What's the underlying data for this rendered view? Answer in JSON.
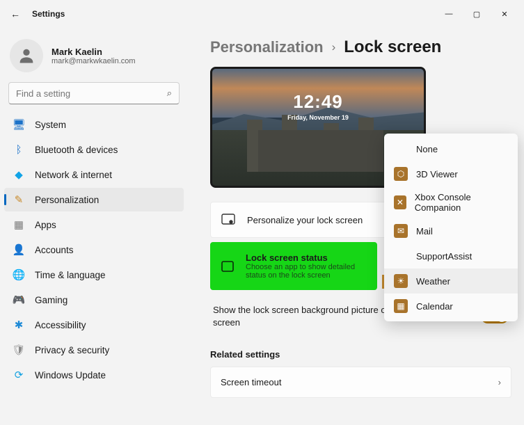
{
  "app": {
    "title": "Settings",
    "back_glyph": "←"
  },
  "window_controls": {
    "min": "—",
    "max": "▢",
    "close": "✕"
  },
  "profile": {
    "name": "Mark Kaelin",
    "email": "mark@markwkaelin.com"
  },
  "search": {
    "placeholder": "Find a setting"
  },
  "sidebar": {
    "items": [
      {
        "label": "System",
        "glyph": "🖥",
        "color": "#1e73c9"
      },
      {
        "label": "Bluetooth & devices",
        "glyph": "ᛒ",
        "color": "#1e73c9"
      },
      {
        "label": "Network & internet",
        "glyph": "◆",
        "color": "#11a3e6"
      },
      {
        "label": "Personalization",
        "glyph": "✎",
        "color": "#c88a2b"
      },
      {
        "label": "Apps",
        "glyph": "▦",
        "color": "#7e7e7e"
      },
      {
        "label": "Accounts",
        "glyph": "👤",
        "color": "#2a9d4d"
      },
      {
        "label": "Time & language",
        "glyph": "🌐",
        "color": "#4a7bb8"
      },
      {
        "label": "Gaming",
        "glyph": "🎮",
        "color": "#6b6b6b"
      },
      {
        "label": "Accessibility",
        "glyph": "✱",
        "color": "#1e8ad6"
      },
      {
        "label": "Privacy & security",
        "glyph": "🛡",
        "color": "#8a8a8a"
      },
      {
        "label": "Windows Update",
        "glyph": "⟳",
        "color": "#13a1e1"
      }
    ],
    "active_index": 3
  },
  "breadcrumb": {
    "parent": "Personalization",
    "sep": "›",
    "current": "Lock screen"
  },
  "preview": {
    "time": "12:49",
    "date": "Friday, November 19"
  },
  "rows": {
    "personalize": {
      "title": "Personalize your lock screen"
    },
    "status": {
      "title": "Lock screen status",
      "subtitle": "Choose an app to show detailed status on the lock screen"
    },
    "signin": {
      "text": "Show the lock screen background picture on the sign-in screen",
      "state_label": "On"
    },
    "timeout": {
      "title": "Screen timeout"
    }
  },
  "section": {
    "related": "Related settings"
  },
  "dropdown": {
    "items": [
      {
        "label": "None",
        "icon": ""
      },
      {
        "label": "3D Viewer",
        "icon": "⬡"
      },
      {
        "label": "Xbox Console Companion",
        "icon": "✕"
      },
      {
        "label": "Mail",
        "icon": "✉"
      },
      {
        "label": "SupportAssist",
        "icon": ""
      },
      {
        "label": "Weather",
        "icon": "☀"
      },
      {
        "label": "Calendar",
        "icon": "▦"
      }
    ],
    "selected_index": 5
  }
}
